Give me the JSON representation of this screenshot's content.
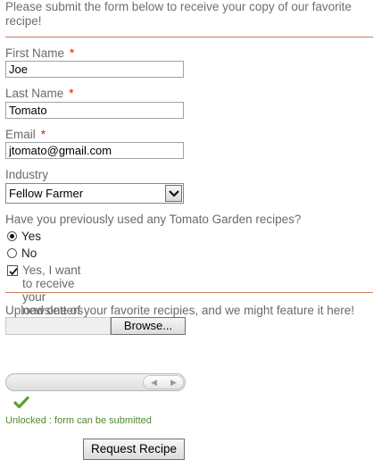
{
  "intro_text": "Please submit the form below to receive your copy of our favorite recipe!",
  "form": {
    "first_name": {
      "label": "First Name",
      "required_mark": "*",
      "value": "Joe"
    },
    "last_name": {
      "label": "Last Name",
      "required_mark": "*",
      "value": "Tomato"
    },
    "email": {
      "label": "Email",
      "required_mark": "*",
      "value": "jtomato@gmail.com"
    },
    "industry": {
      "label": "Industry",
      "selected": "Fellow Farmer"
    },
    "previous_question": "Have you previously used any Tomato Garden recipes?",
    "options": [
      {
        "label": "Yes",
        "selected": true
      },
      {
        "label": "No",
        "selected": false
      }
    ],
    "newsletter": {
      "label": "Yes, I want to receive your newsletters",
      "checked": true
    },
    "upload_prompt": "Upload one of your favorite recipies, and we might feature it here!",
    "browse_label": "Browse...",
    "unlock_status": "Unlocked : form can be submitted",
    "submit_label": "Request Recipe"
  },
  "colors": {
    "rule": "#c9785b",
    "required": "#cc2200",
    "status": "#4d8a2d",
    "checkmark": "#57a32f"
  },
  "icons": [
    "select-arrow-icon",
    "checkmark-icon",
    "chevron-left-icon",
    "chevron-right-icon"
  ]
}
